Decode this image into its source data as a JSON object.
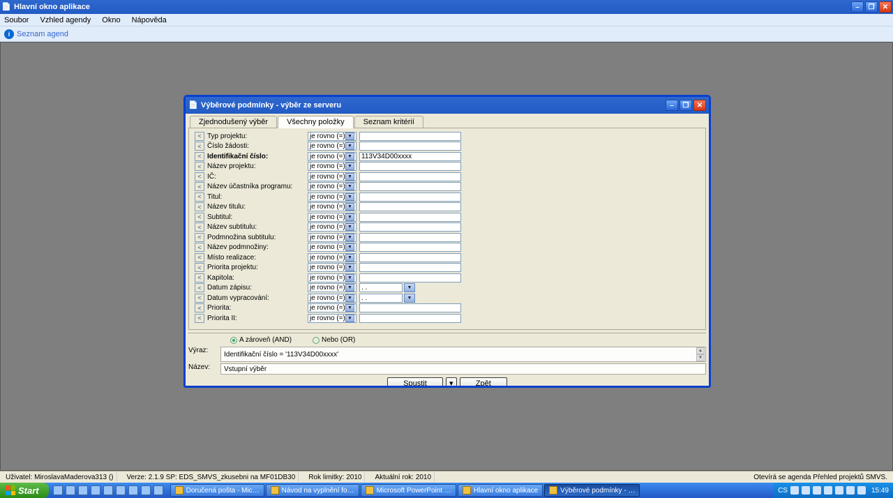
{
  "mainWindow": {
    "title": "Hlavní okno aplikace",
    "menu": [
      "Soubor",
      "Vzhled agendy",
      "Okno",
      "Nápověda"
    ],
    "toolbarLink": "Seznam agend"
  },
  "dialog": {
    "title": "Výběrové podmínky - výběr ze serveru",
    "tabs": [
      "Zjednodušený výběr",
      "Všechny položky",
      "Seznam kritérií"
    ],
    "activeTab": 1,
    "opLabel": "je rovno (=)",
    "fields": [
      {
        "label": "Typ projektu:",
        "value": "",
        "type": "text"
      },
      {
        "label": "Číslo žádosti:",
        "value": "",
        "type": "text"
      },
      {
        "label": "Identifikační číslo:",
        "value": "113V34D00xxxx",
        "type": "text",
        "bold": true
      },
      {
        "label": "Název projektu:",
        "value": "",
        "type": "text"
      },
      {
        "label": "IČ:",
        "value": "",
        "type": "text"
      },
      {
        "label": "Název účastníka programu:",
        "value": "",
        "type": "text"
      },
      {
        "label": "Titul:",
        "value": "",
        "type": "text"
      },
      {
        "label": "Název titulu:",
        "value": "",
        "type": "text"
      },
      {
        "label": "Subtitul:",
        "value": "",
        "type": "text"
      },
      {
        "label": "Název subtitulu:",
        "value": "",
        "type": "text"
      },
      {
        "label": "Podmnožina subtitulu:",
        "value": "",
        "type": "text"
      },
      {
        "label": "Název podmnožiny:",
        "value": "",
        "type": "text"
      },
      {
        "label": "Místo realizace:",
        "value": "",
        "type": "text"
      },
      {
        "label": "Priorita projektu:",
        "value": "",
        "type": "text"
      },
      {
        "label": "Kapitola:",
        "value": "",
        "type": "text"
      },
      {
        "label": "Datum zápisu:",
        "value": "  .  .    ",
        "type": "date"
      },
      {
        "label": "Datum vypracování:",
        "value": "  .  .    ",
        "type": "date"
      },
      {
        "label": "Priorita:",
        "value": "",
        "type": "text"
      },
      {
        "label": "Priorita II:",
        "value": "",
        "type": "text"
      }
    ],
    "logic": {
      "and": "A zároveň (AND)",
      "or": "Nebo (OR)",
      "selected": "and"
    },
    "exprLabel": "Výraz:",
    "exprValue": "Identifikační číslo = '113V34D00xxxx'",
    "nameLabel": "Název:",
    "nameValue": "Vstupní výběr",
    "buttons": {
      "run": "Spustit",
      "back": "Zpět"
    }
  },
  "status": {
    "user": "Uživatel: MiroslavaMaderova313 ()",
    "version": "Verze: 2.1.9 SP: EDS_SMVS_zkusebni na MF01DB30",
    "limitYear": "Rok limitky: 2010",
    "actualYear": "Aktuální rok: 2010",
    "right": "Otevírá se agenda Přehled projektů SMVS."
  },
  "taskbar": {
    "start": "Start",
    "tasks": [
      "Doručená pošta - Mic…",
      "Návod na vyplnění fo…",
      "Microsoft PowerPoint …",
      "Hlavní okno aplikace",
      "Výběrové podmínky - …"
    ],
    "activeTask": 4,
    "lang": "CS",
    "clock": "15:49"
  }
}
